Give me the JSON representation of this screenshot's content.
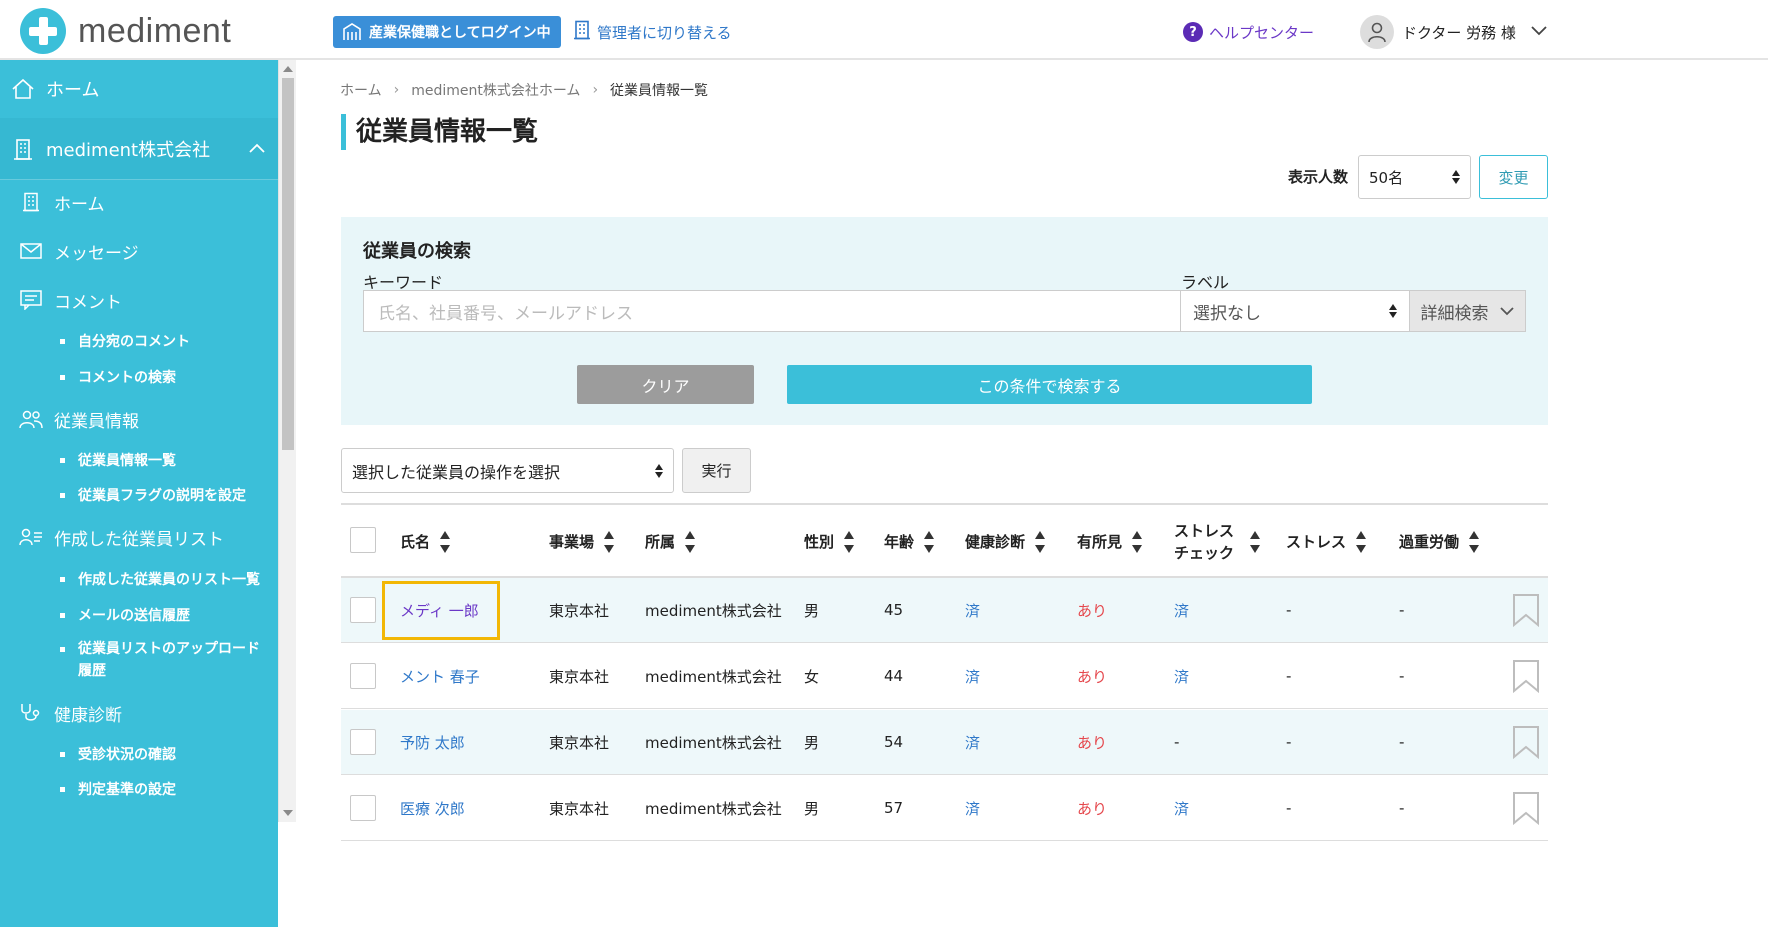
{
  "header": {
    "logo_text": "mediment",
    "role_badge": "産業保健職としてログイン中",
    "switch_admin": "管理者に切り替える",
    "help": "ヘルプセンター",
    "user_name": "ドクター 労務 様"
  },
  "sidebar": {
    "home": "ホーム",
    "company": "mediment株式会社",
    "company_home": "ホーム",
    "messages": "メッセージ",
    "comments": "コメント",
    "comments_sub": [
      "自分宛のコメント",
      "コメントの検索"
    ],
    "employee_info": "従業員情報",
    "employee_info_sub": [
      "従業員情報一覧",
      "従業員フラグの説明を設定"
    ],
    "created_lists": "作成した従業員リスト",
    "created_lists_sub": [
      "作成した従業員のリスト一覧",
      "メールの送信履歴",
      "従業員リストのアップロード履歴"
    ],
    "health_check": "健康診断",
    "health_check_sub": [
      "受診状況の確認",
      "判定基準の設定"
    ]
  },
  "breadcrumb": [
    "ホーム",
    "mediment株式会社ホーム",
    "従業員情報一覧"
  ],
  "page_title": "従業員情報一覧",
  "display": {
    "label": "表示人数",
    "value": "50名",
    "change": "変更"
  },
  "search": {
    "title": "従業員の検索",
    "keyword_label": "キーワード",
    "keyword_placeholder": "氏名、社員番号、メールアドレス",
    "label_label": "ラベル",
    "label_value": "選択なし",
    "detail": "詳細検索",
    "clear": "クリア",
    "submit": "この条件で検索する"
  },
  "bulk": {
    "select": "選択した従業員の操作を選択",
    "execute": "実行"
  },
  "table": {
    "headers": [
      "氏名",
      "事業場",
      "所属",
      "性別",
      "年齢",
      "健康診断",
      "有所見",
      "ストレス\nチェック",
      "ストレス",
      "過重労働"
    ],
    "rows": [
      {
        "name": "メディ 一郎",
        "site": "東京本社",
        "dept": "mediment株式会社",
        "sex": "男",
        "age": "45",
        "checkup": "済",
        "finding": "あり",
        "stress_check": "済",
        "stress": "-",
        "overwork": "-"
      },
      {
        "name": "メント 春子",
        "site": "東京本社",
        "dept": "mediment株式会社",
        "sex": "女",
        "age": "44",
        "checkup": "済",
        "finding": "あり",
        "stress_check": "済",
        "stress": "-",
        "overwork": "-"
      },
      {
        "name": "予防 太郎",
        "site": "東京本社",
        "dept": "mediment株式会社",
        "sex": "男",
        "age": "54",
        "checkup": "済",
        "finding": "あり",
        "stress_check": "-",
        "stress": "-",
        "overwork": "-"
      },
      {
        "name": "医療 次郎",
        "site": "東京本社",
        "dept": "mediment株式会社",
        "sex": "男",
        "age": "57",
        "checkup": "済",
        "finding": "あり",
        "stress_check": "済",
        "stress": "-",
        "overwork": "-"
      }
    ]
  },
  "colors": {
    "accent": "#3bbfd9",
    "link": "#2f78c9",
    "visited": "#6b38c7",
    "alert": "#e5484d",
    "highlight": "#f2b705"
  }
}
